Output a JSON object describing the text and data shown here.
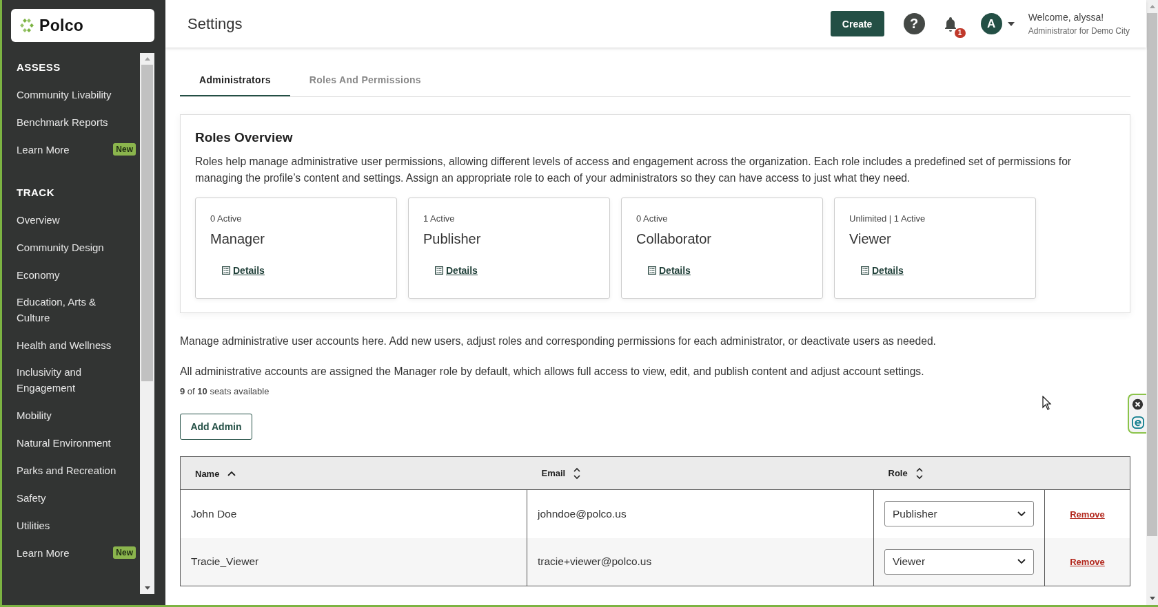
{
  "sidebar": {
    "logo": "Polco",
    "sections": [
      {
        "heading": "ASSESS",
        "items": [
          {
            "label": "Community Livability"
          },
          {
            "label": "Benchmark Reports"
          },
          {
            "label": "Learn More",
            "badge": "New"
          }
        ]
      },
      {
        "heading": "TRACK",
        "items": [
          {
            "label": "Overview"
          },
          {
            "label": "Community Design"
          },
          {
            "label": "Economy"
          },
          {
            "label": "Education, Arts & Culture"
          },
          {
            "label": "Health and Wellness"
          },
          {
            "label": "Inclusivity and Engagement"
          },
          {
            "label": "Mobility"
          },
          {
            "label": "Natural Environment"
          },
          {
            "label": "Parks and Recreation"
          },
          {
            "label": "Safety"
          },
          {
            "label": "Utilities"
          },
          {
            "label": "Learn More",
            "badge": "New"
          }
        ]
      }
    ]
  },
  "header": {
    "title": "Settings",
    "create_button": "Create",
    "help": "?",
    "notifications": "1",
    "avatar": "A",
    "welcome": "Welcome, alyssa!",
    "subtitle": "Administrator for Demo City"
  },
  "tabs": [
    {
      "label": "Administrators",
      "selected": true
    },
    {
      "label": "Roles And Permissions",
      "selected": false
    }
  ],
  "roles_overview": {
    "title": "Roles Overview",
    "description": "Roles help manage administrative user permissions, allowing different levels of access and engagement across the organization. Each role includes a predefined set of permissions for managing the profile’s content and settings. Assign an appropriate role to each of your administrators so they can have access to just what they need.",
    "roles": [
      {
        "count": "0 Active",
        "name": "Manager",
        "link": "Details"
      },
      {
        "count": "1 Active",
        "name": "Publisher",
        "link": "Details"
      },
      {
        "count": "0 Active",
        "name": "Collaborator",
        "link": "Details"
      },
      {
        "count": "Unlimited | 1 Active",
        "name": "Viewer",
        "link": "Details"
      }
    ]
  },
  "intro": [
    "Manage administrative user accounts here. Add new users, adjust roles and corresponding permissions for each administrator, or deactivate users as needed.",
    "All administrative accounts are assigned the Manager role by default, which allows full access to view, edit, and publish content and adjust account settings."
  ],
  "seats": "**9** of **10** seats available",
  "add_button": "Add Admin",
  "table": {
    "columns": [
      {
        "label": "Name",
        "sorted": true
      },
      {
        "label": "Email",
        "sorted": false
      },
      {
        "label": "Role",
        "sorted": false
      }
    ],
    "rows": [
      {
        "name": "John Doe",
        "email": "johndoe@polco.us",
        "role": "Publisher",
        "action": "Remove"
      },
      {
        "name": "Tracie_Viewer",
        "email": "tracie+viewer@polco.us",
        "role": "Viewer",
        "action": "Remove"
      }
    ]
  }
}
